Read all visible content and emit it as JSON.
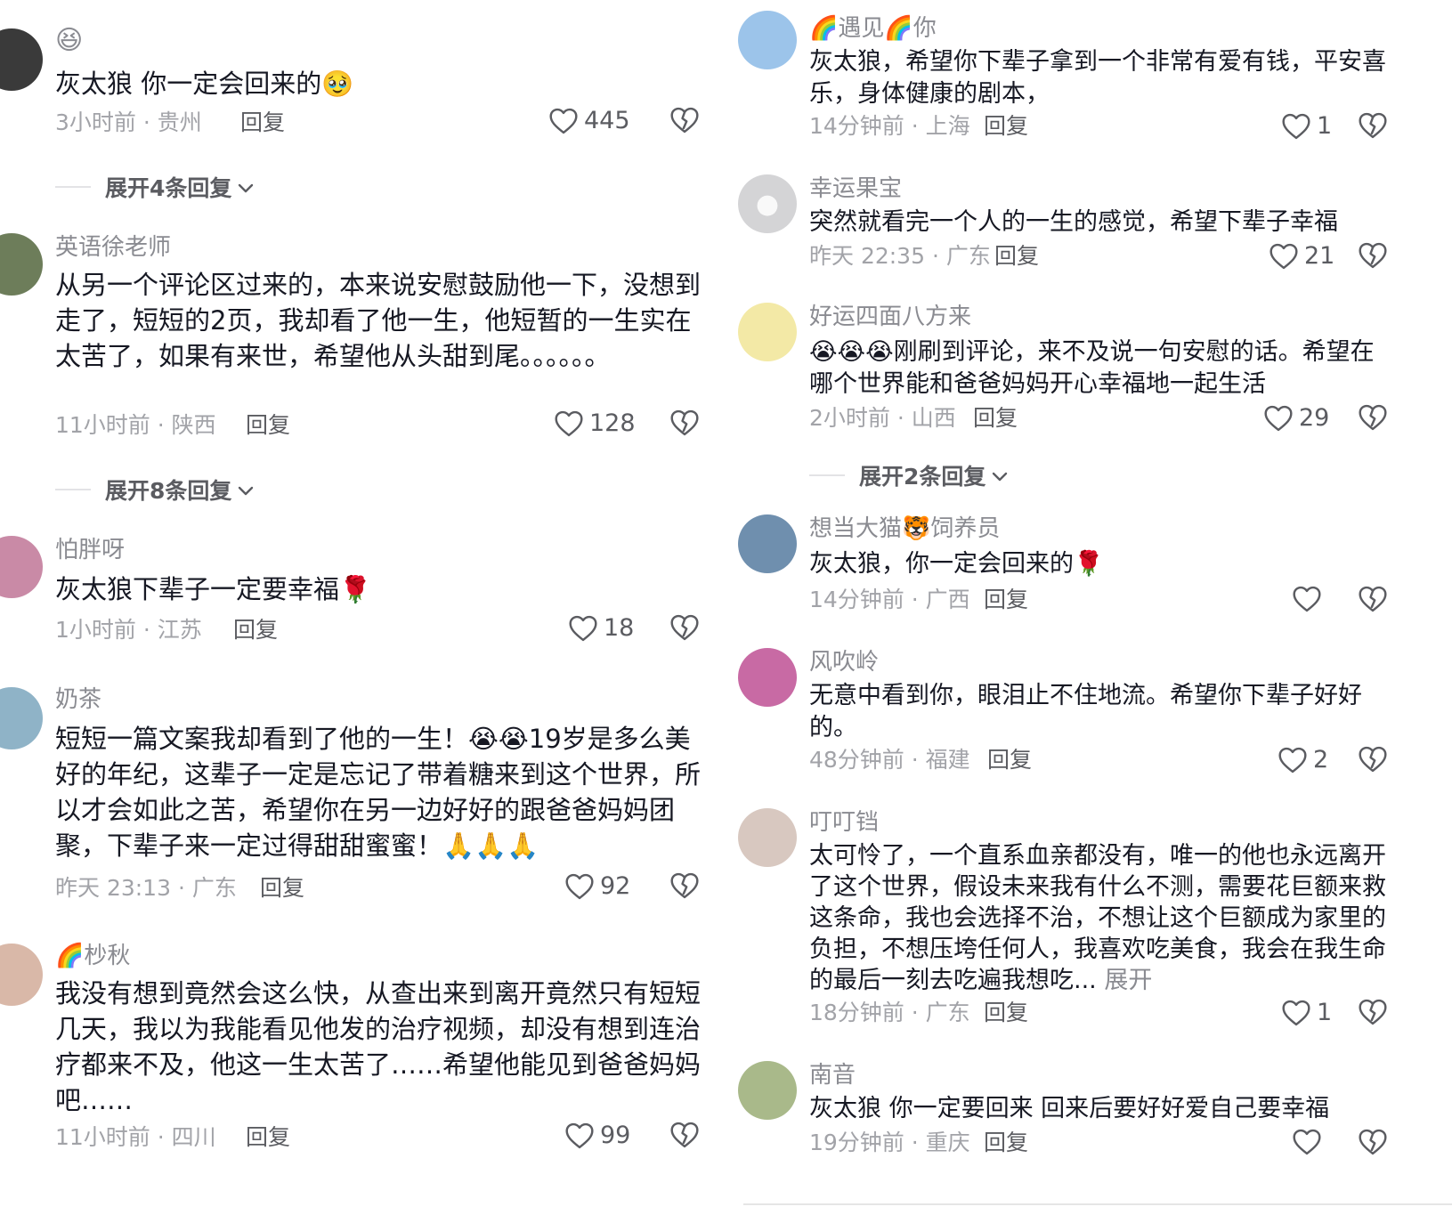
{
  "left_column": {
    "comments": [
      {
        "username": "",
        "username_prefix_emoji": "😆",
        "text": "灰太狼 你一定会回来的🥹",
        "time": "3小时前",
        "location": "贵州",
        "reply_label": "回复",
        "likes": "445",
        "avatar_color": "#3a3a3a",
        "expand_label": "展开4条回复"
      },
      {
        "username": "英语徐老师",
        "text": "从另一个评论区过来的，本来说安慰鼓励他一下，没想到走了，短短的2页，我却看了他一生，他短暂的一生实在太苦了，如果有来世，希望他从头甜到尾。。。。。。",
        "time": "11小时前",
        "location": "陕西",
        "reply_label": "回复",
        "likes": "128",
        "avatar_color": "#6d7d5a",
        "expand_label": "展开8条回复"
      },
      {
        "username": "怕胖呀",
        "text": "灰太狼下辈子一定要幸福🌹",
        "time": "1小时前",
        "location": "江苏",
        "reply_label": "回复",
        "likes": "18",
        "avatar_color": "#c98aa6"
      },
      {
        "username": "奶茶",
        "text": "短短一篇文案我却看到了他的一生！😭😭19岁是多么美好的年纪，这辈子一定是忘记了带着糖来到这个世界，所以才会如此之苦，希望你在另一边好好的跟爸爸妈妈团聚，下辈子来一定过得甜甜蜜蜜！🙏🙏🙏",
        "time": "昨天 23:13",
        "location": "广东",
        "reply_label": "回复",
        "likes": "92",
        "avatar_color": "#8fb3c7"
      },
      {
        "username": "🌈杪秋",
        "text": "我没有想到竟然会这么快，从查出来到离开竟然只有短短几天，我以为我能看见他发的治疗视频，却没有想到连治疗都来不及，他这一生太苦了……希望他能见到爸爸妈妈吧……",
        "time": "11小时前",
        "location": "四川",
        "reply_label": "回复",
        "likes": "99",
        "avatar_color": "#d9b8a8"
      }
    ]
  },
  "right_column": {
    "comments": [
      {
        "username": "🌈遇见🌈你",
        "text": "灰太狼，希望你下辈子拿到一个非常有爱有钱，平安喜乐，身体健康的剧本，",
        "time": "14分钟前",
        "location": "上海",
        "reply_label": "回复",
        "likes": "1",
        "avatar_color": "#9cc4ea"
      },
      {
        "username": "幸运果宝",
        "text": "突然就看完一个人的一生的感觉，希望下辈子幸福",
        "time": "昨天 22:35",
        "location": "广东",
        "reply_label": "回复",
        "likes": "21",
        "avatar_color": "#d4d4d6"
      },
      {
        "username": "好运四面八方来",
        "text": "😭😭😭刚刷到评论，来不及说一句安慰的话。希望在哪个世界能和爸爸妈妈开心幸福地一起生活",
        "time": "2小时前",
        "location": "山西",
        "reply_label": "回复",
        "likes": "29",
        "avatar_color": "#f3e9a6",
        "expand_label": "展开2条回复"
      },
      {
        "username": "想当大猫🐯饲养员",
        "text": "灰太狼，你一定会回来的🌹",
        "time": "14分钟前",
        "location": "广西",
        "reply_label": "回复",
        "likes": "",
        "avatar_color": "#6f8fae"
      },
      {
        "username": "风吹岭",
        "text": "无意中看到你，眼泪止不住地流。希望你下辈子好好的。",
        "time": "48分钟前",
        "location": "福建",
        "reply_label": "回复",
        "likes": "2",
        "avatar_color": "#c86aa4"
      },
      {
        "username": "叮叮铛",
        "text": "太可怜了，一个直系血亲都没有，唯一的他也永远离开了这个世界，假设未来我有什么不测，需要花巨额来救这条命，我也会选择不治，不想让这个巨额成为家里的负担，不想压垮任何人，我喜欢吃美食，我会在我生命的最后一刻去吃遍我想吃...",
        "more_label": "展开",
        "time": "18分钟前",
        "location": "广东",
        "reply_label": "回复",
        "likes": "1",
        "avatar_color": "#d8c8c0"
      },
      {
        "username": "南音",
        "text": "灰太狼 你一定要回来 回来后要好好爱自己要幸福",
        "time": "19分钟前",
        "location": "重庆",
        "reply_label": "回复",
        "likes": "",
        "avatar_color": "#a9b98a"
      }
    ]
  },
  "meta_separator": " · ",
  "icons": {
    "like": "heart-outline-icon",
    "dislike": "broken-heart-icon",
    "expand": "chevron-down-icon",
    "avatar_placeholder": "person-icon"
  }
}
